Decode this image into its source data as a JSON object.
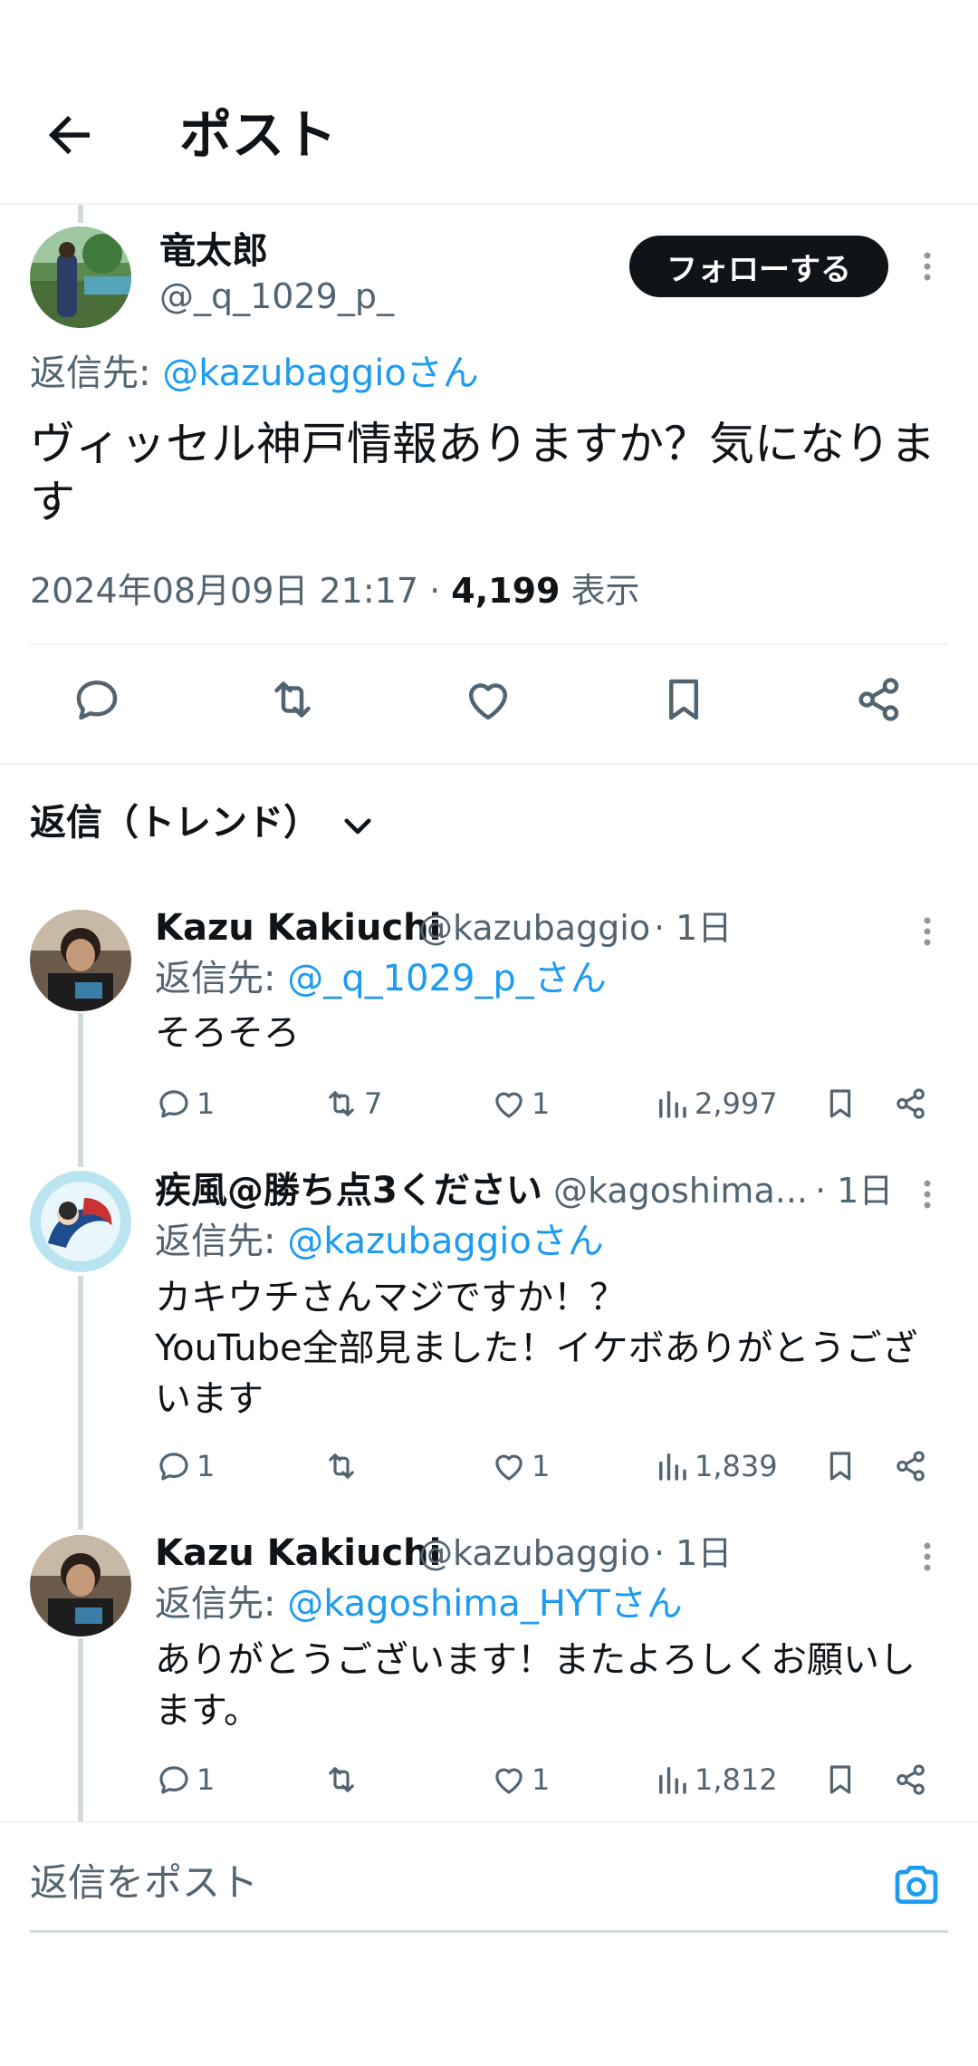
{
  "header": {
    "title": "ポスト"
  },
  "main_post": {
    "display_name": "竜太郎",
    "handle": "@_q_1029_p_",
    "follow_label": "フォローする",
    "reply_to_prefix": "返信先: ",
    "reply_to_mention": "@kazubaggioさん",
    "text": "ヴィッセル神戸情報ありますか？気になります",
    "timestamp": "2024年08月09日 21:17 · ",
    "views_count": "4,199",
    "views_label": " 表示"
  },
  "replies_sort": {
    "label": "返信（トレンド）"
  },
  "replies": [
    {
      "display_name": "Kazu Kakiuchi",
      "handle": "@kazubaggio",
      "time": "· 1日",
      "reply_to_prefix": "返信先: ",
      "reply_to_mention": "@_q_1029_p_さん",
      "text": "そろそろ",
      "reply_count": "1",
      "repost_count": "7",
      "like_count": "1",
      "view_count": "2,997"
    },
    {
      "display_name": "疾風@勝ち点3ください",
      "handle": "@kagoshima...",
      "time": "· 1日",
      "reply_to_prefix": "返信先: ",
      "reply_to_mention": "@kazubaggioさん",
      "text": "カキウチさんマジですか！？\nYouTube全部見ました！イケボありがとうございます",
      "reply_count": "1",
      "repost_count": "",
      "like_count": "1",
      "view_count": "1,839"
    },
    {
      "display_name": "Kazu Kakiuchi",
      "handle": "@kazubaggio",
      "time": "· 1日",
      "reply_to_prefix": "返信先: ",
      "reply_to_mention": "@kagoshima_HYTさん",
      "text": "ありがとうございます！またよろしくお願いします。",
      "reply_count": "1",
      "repost_count": "",
      "like_count": "1",
      "view_count": "1,812"
    }
  ],
  "composer": {
    "placeholder": "返信をポスト"
  },
  "colors": {
    "accent": "#1d9bf0",
    "text": "#0f1419",
    "muted": "#536471",
    "divider": "#eff3f4"
  }
}
